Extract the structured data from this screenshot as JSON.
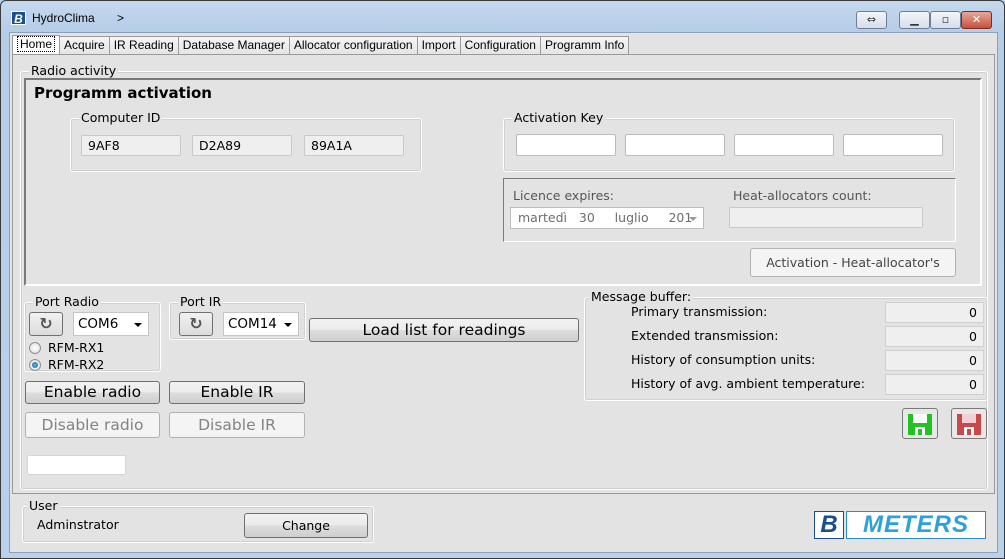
{
  "window": {
    "title": "HydroClima",
    "title_suffix": ">",
    "icon_letter": "B",
    "controls": {
      "restore_size": "⇔",
      "minimize": "▭",
      "maximize": "▣",
      "close": "✕"
    }
  },
  "tabs": [
    {
      "label": "Home",
      "active": true
    },
    {
      "label": "Acquire"
    },
    {
      "label": "IR Reading"
    },
    {
      "label": "Database Manager"
    },
    {
      "label": "Allocator configuration"
    },
    {
      "label": "Import"
    },
    {
      "label": "Configuration"
    },
    {
      "label": "Programm Info"
    }
  ],
  "radio_activity": {
    "label": "Radio activity",
    "activation": {
      "title": "Programm activation",
      "computer_id": {
        "label": "Computer ID",
        "parts": [
          "9AF8",
          "D2A89",
          "89A1A"
        ]
      },
      "activation_key": {
        "label": "Activation Key",
        "parts": [
          "",
          "",
          "",
          ""
        ]
      },
      "licence": {
        "expires_label": "Licence expires:",
        "expires_value": "martedì   30     luglio     201",
        "count_label": "Heat-allocators count:",
        "count_value": ""
      },
      "activation_button": "Activation - Heat-allocator's"
    },
    "port_radio": {
      "label": "Port Radio",
      "refresh_icon": "refresh-icon",
      "port": "COM6",
      "options": [
        {
          "label": "RFM-RX1",
          "selected": false
        },
        {
          "label": "RFM-RX2",
          "selected": true
        }
      ]
    },
    "port_ir": {
      "label": "Port IR",
      "port": "COM14"
    },
    "load_list_button": "Load list for readings",
    "enable_radio": "Enable radio",
    "enable_ir": "Enable IR",
    "disable_radio": "Disable radio",
    "disable_ir": "Disable IR",
    "status_field": "",
    "message_buffer": {
      "label": "Message buffer:",
      "rows": [
        {
          "label": "Primary transmission:",
          "value": "0"
        },
        {
          "label": "Extended transmission:",
          "value": "0"
        },
        {
          "label": "History of consumption units:",
          "value": "0"
        },
        {
          "label": "History of avg. ambient temperature:",
          "value": "0"
        }
      ],
      "save_green_icon": "floppy-save-green-icon",
      "save_red_icon": "floppy-save-red-icon",
      "colors": {
        "green": "#22c322",
        "red": "#c8494a"
      }
    }
  },
  "user": {
    "label": "User",
    "name": "Adminstrator",
    "change_button": "Change"
  },
  "logo": {
    "b": "B",
    "meters": "METERS",
    "colors": {
      "dark": "#1b4f8c",
      "light": "#2ea2d8"
    }
  }
}
